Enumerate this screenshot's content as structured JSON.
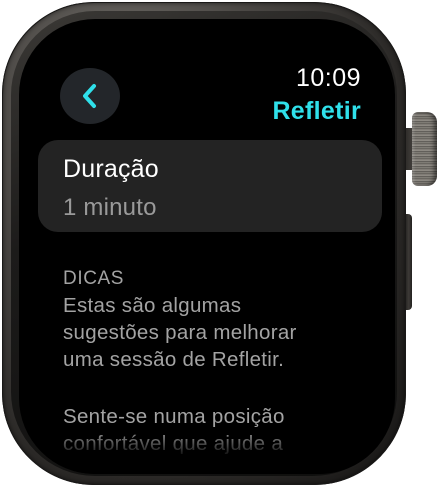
{
  "status_bar": {
    "time": "10:09"
  },
  "header": {
    "app_title": "Refletir",
    "back_icon": "chevron-left-icon",
    "accent_color": "#2fe0ea"
  },
  "duration": {
    "label": "Duração",
    "value": "1 minuto"
  },
  "tips": {
    "heading": "DICAS",
    "text": "Estas são algumas\nsugestões para melhorar\numa sessão de Refletir.",
    "text2": "Sente-se numa posição\nconfortável que ajude a"
  },
  "device": {
    "crown_icon": "digital-crown",
    "side_button_icon": "side-button"
  }
}
